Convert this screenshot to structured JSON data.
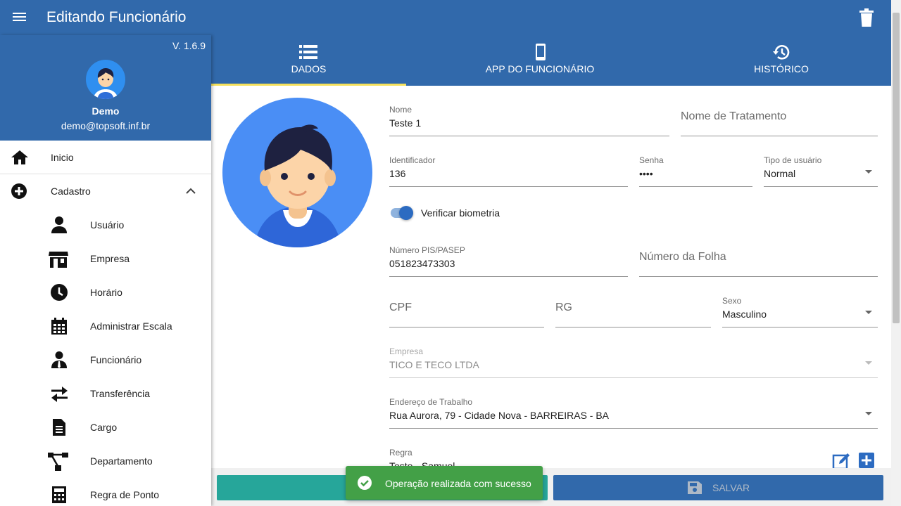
{
  "header": {
    "title": "Editando Funcionário"
  },
  "sidebar": {
    "version": "V. 1.6.9",
    "user_name": "Demo",
    "user_email": "demo@topsoft.inf.br",
    "items": [
      {
        "label": "Inicio",
        "icon": "home-icon"
      },
      {
        "label": "Cadastro",
        "icon": "add-circle-icon"
      },
      {
        "label": "Usuário",
        "icon": "person-icon"
      },
      {
        "label": "Empresa",
        "icon": "store-icon"
      },
      {
        "label": "Horário",
        "icon": "clock-icon"
      },
      {
        "label": "Administrar Escala",
        "icon": "calendar-icon"
      },
      {
        "label": "Funcionário",
        "icon": "employee-icon"
      },
      {
        "label": "Transferência",
        "icon": "swap-icon"
      },
      {
        "label": "Cargo",
        "icon": "document-icon"
      },
      {
        "label": "Departamento",
        "icon": "hierarchy-icon"
      },
      {
        "label": "Regra de Ponto",
        "icon": "calculator-icon"
      }
    ]
  },
  "tabs": [
    {
      "label": "DADOS",
      "icon": "list-icon"
    },
    {
      "label": "APP DO FUNCIONÁRIO",
      "icon": "phone-icon"
    },
    {
      "label": "HISTÓRICO",
      "icon": "history-icon"
    }
  ],
  "form": {
    "nome": {
      "label": "Nome",
      "value": "Teste 1"
    },
    "nome_tratamento": {
      "placeholder": "Nome de Tratamento"
    },
    "identificador": {
      "label": "Identificador",
      "value": "136"
    },
    "senha": {
      "label": "Senha",
      "value": "••••"
    },
    "tipo_usuario": {
      "label": "Tipo de usuário",
      "value": "Normal"
    },
    "biometria": {
      "label": "Verificar biometria",
      "checked": true
    },
    "pis": {
      "label": "Número PIS/PASEP",
      "value": "051823473303"
    },
    "numero_folha": {
      "placeholder": "Número da Folha"
    },
    "cpf": {
      "placeholder": "CPF"
    },
    "rg": {
      "placeholder": "RG"
    },
    "sexo": {
      "label": "Sexo",
      "value": "Masculino"
    },
    "empresa": {
      "label": "Empresa",
      "value": "TICO E TECO LTDA"
    },
    "endereco": {
      "label": "Endereço de Trabalho",
      "value": "Rua Aurora, 79 - Cidade Nova - BARREIRAS - BA"
    },
    "regra": {
      "label": "Regra",
      "value": "Teste - Samuel"
    }
  },
  "buttons": {
    "save_label": "SALVAR"
  },
  "toast": {
    "message": "Operação realizada com sucesso"
  },
  "colors": {
    "primary": "#3169ab",
    "accent": "#f5e15d",
    "success": "#43a047",
    "teal": "#26a69a"
  }
}
